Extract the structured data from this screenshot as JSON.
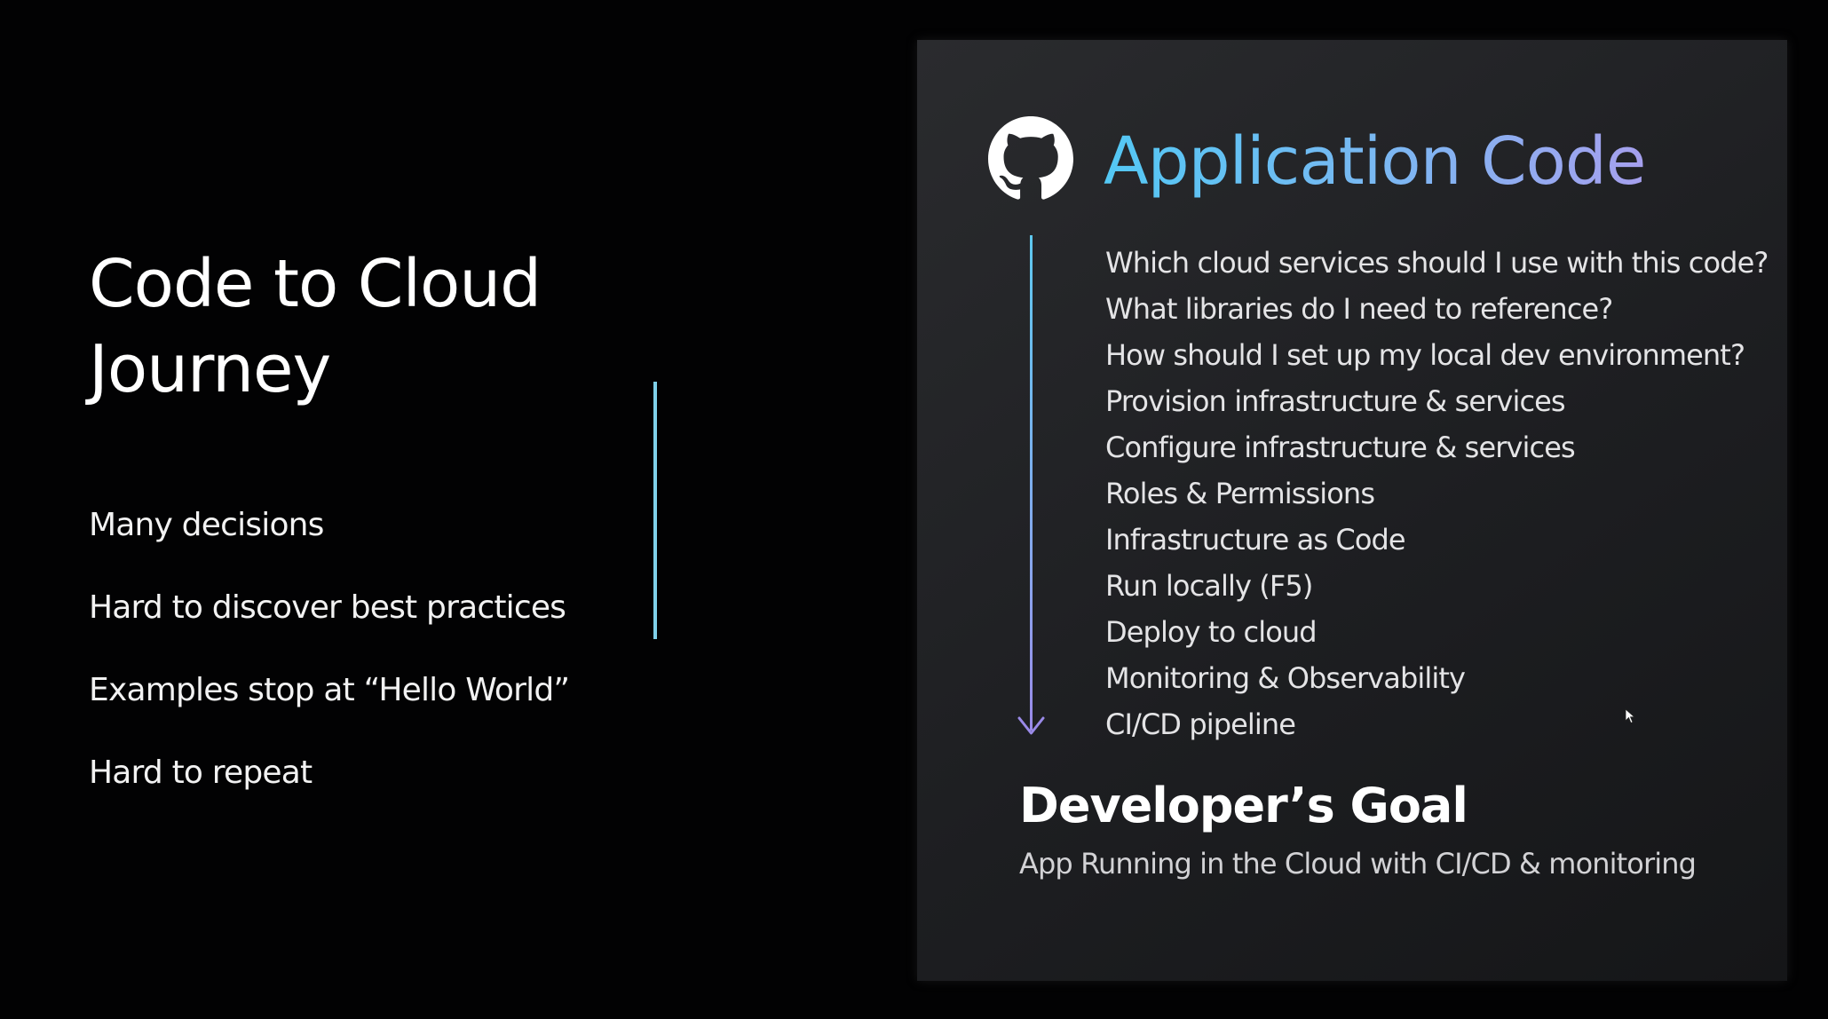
{
  "slide": {
    "title_line1": "Code to Cloud",
    "title_line2": "Journey",
    "bullets": [
      "Many decisions",
      "Hard to discover best practices",
      "Examples stop at “Hello World”",
      "Hard to repeat"
    ]
  },
  "panel": {
    "icon": "github-icon",
    "title": "Application Code",
    "steps": [
      "Which cloud services should I use with this code?",
      "What libraries do I need to reference?",
      "How should I set up my local dev environment?",
      "Provision infrastructure & services",
      "Configure infrastructure & services",
      "Roles & Permissions",
      "Infrastructure as Code",
      "Run locally (F5)",
      "Deploy to cloud",
      "Monitoring & Observability",
      "CI/CD pipeline"
    ],
    "goal_title": "Developer’s Goal",
    "goal_subtitle": "App Running in the Cloud with CI/CD & monitoring"
  },
  "colors": {
    "background": "#020203",
    "accent_cyan": "#5bc6f2",
    "accent_purple": "#9a8ae8",
    "divider": "#7fd0ea"
  }
}
